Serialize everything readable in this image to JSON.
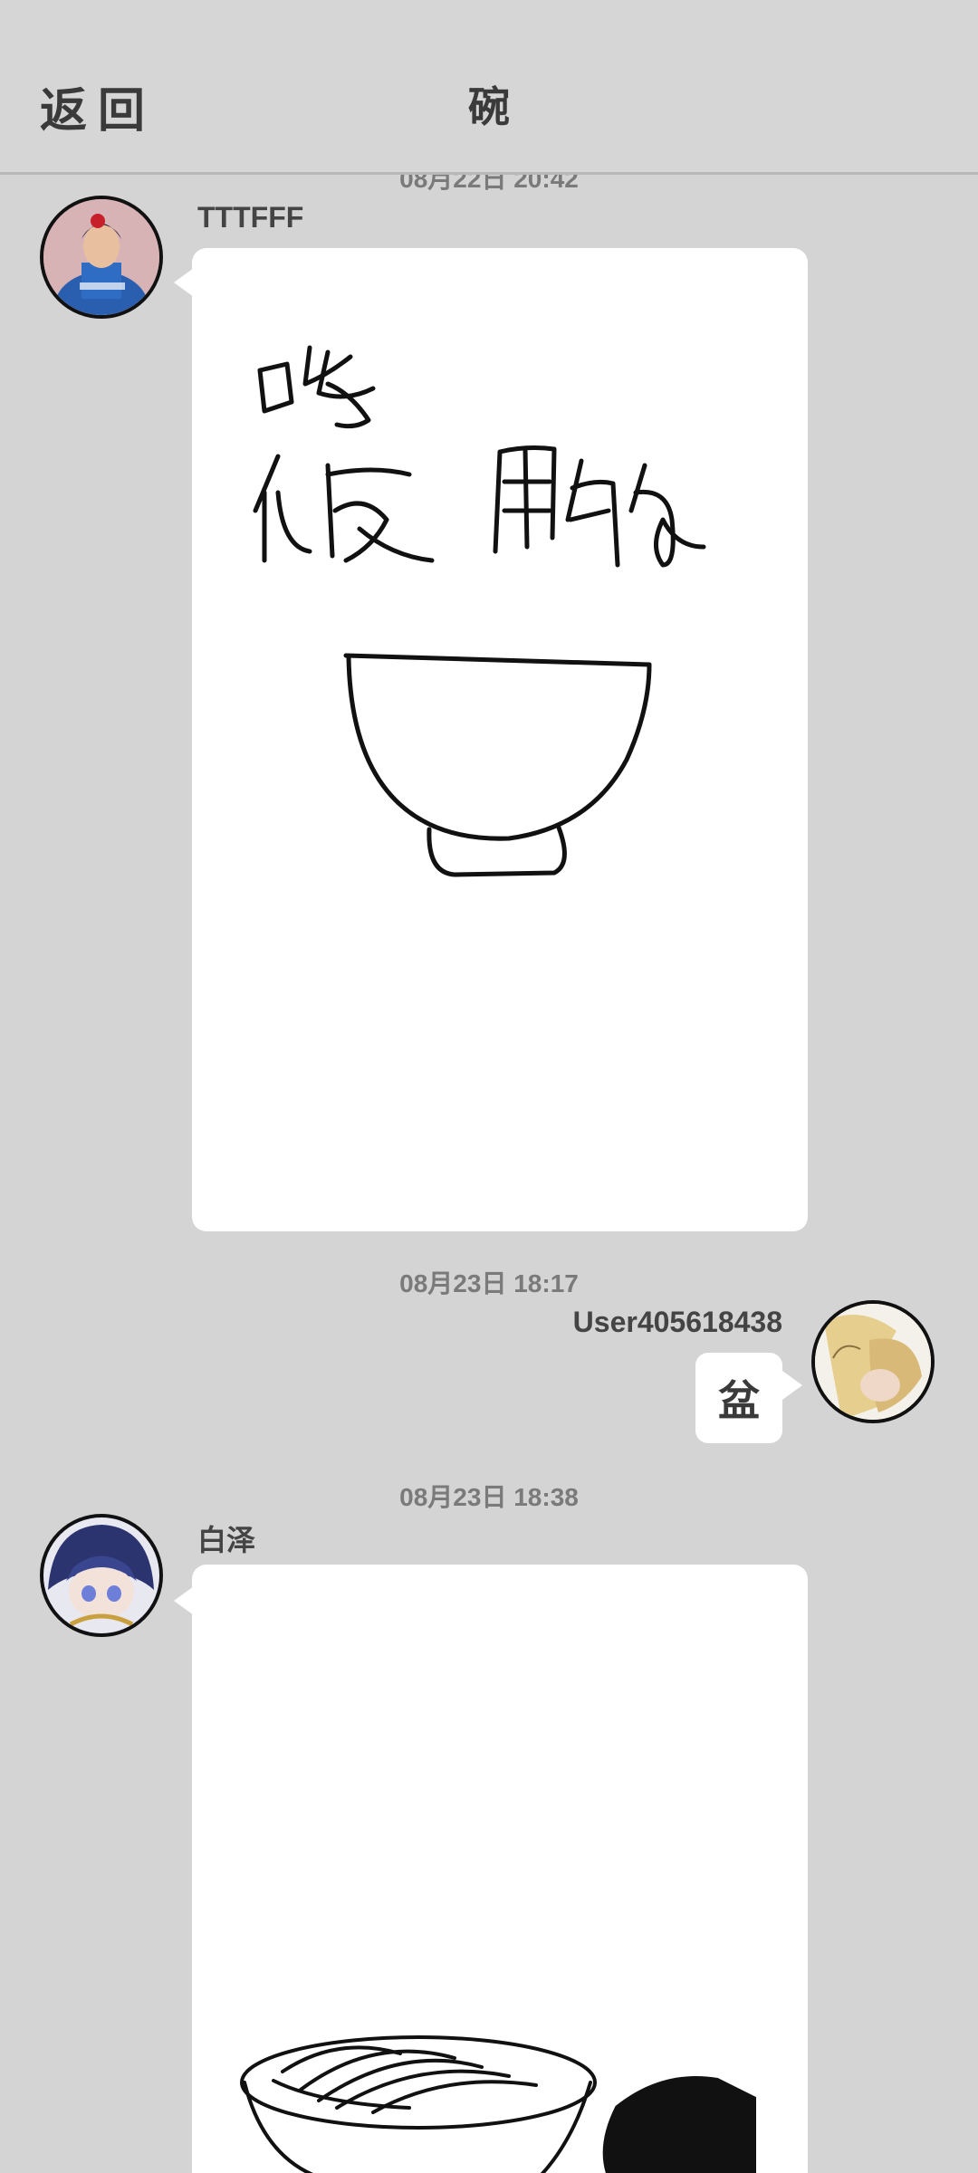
{
  "header": {
    "back_label": "返回",
    "title": "碗"
  },
  "messages": [
    {
      "timestamp": "08月22日 20:42",
      "username": "TTTFFF",
      "avatar_icon": "woman-cartoon-avatar",
      "content_type": "drawing",
      "drawing_text": [
        "吃",
        "饭用的"
      ]
    },
    {
      "timestamp": "08月23日 18:17",
      "username": "User405618438",
      "avatar_icon": "blonde-character-avatar",
      "content_type": "text",
      "text": "盆"
    },
    {
      "timestamp": "08月23日 18:38",
      "username": "白泽",
      "avatar_icon": "anime-character-avatar",
      "content_type": "drawing"
    }
  ],
  "colors": {
    "background": "#d4d4d4",
    "bubble": "#ffffff",
    "text_dark": "#3a3a3a",
    "timestamp": "#7a7a7a"
  }
}
